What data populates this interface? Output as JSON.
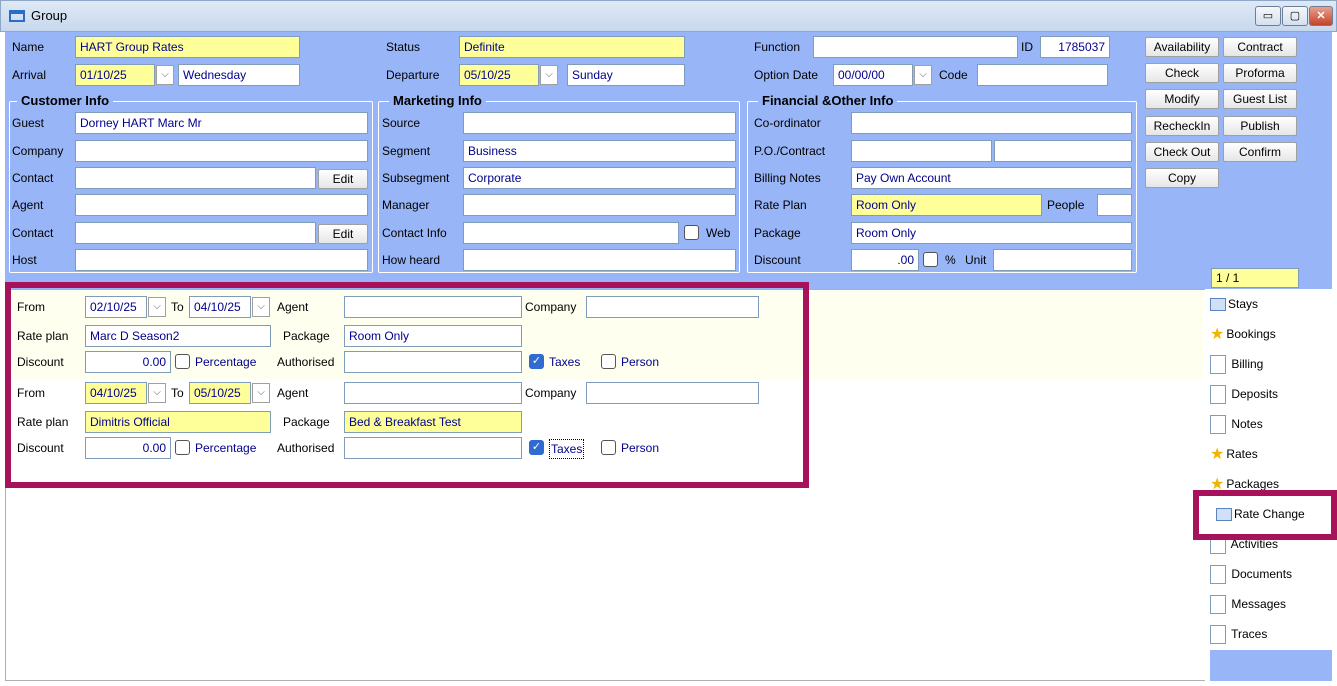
{
  "window": {
    "title": "Group",
    "controls": [
      "▭",
      "▢",
      "✕"
    ]
  },
  "header": {
    "name_label": "Name",
    "name_value": "HART Group Rates",
    "status_label": "Status",
    "status_value": "Definite",
    "function_label": "Function",
    "function_value": "",
    "id_label": "ID",
    "id_value": "1785037",
    "arrival_label": "Arrival",
    "arrival_date": "01/10/25",
    "arrival_day": "Wednesday",
    "departure_label": "Departure",
    "departure_date": "05/10/25",
    "departure_day": "Sunday",
    "option_date_label": "Option Date",
    "option_date_value": "00/00/00",
    "code_label": "Code",
    "code_value": ""
  },
  "customer_info": {
    "title": "Customer Info",
    "guest_label": "Guest",
    "guest_value": "Dorney HART Marc Mr",
    "company_label": "Company",
    "company_value": "",
    "contact_label": "Contact",
    "contact_value": "",
    "edit_label": "Edit",
    "agent_label": "Agent",
    "agent_value": "",
    "contact2_label": "Contact",
    "contact2_value": "",
    "edit2_label": "Edit",
    "host_label": "Host",
    "host_value": ""
  },
  "marketing_info": {
    "title": "Marketing Info",
    "source_label": "Source",
    "source_value": "",
    "segment_label": "Segment",
    "segment_value": "Business",
    "subsegment_label": "Subsegment",
    "subsegment_value": "Corporate",
    "manager_label": "Manager",
    "manager_value": "",
    "contact_info_label": "Contact Info",
    "contact_info_value": "",
    "web_label": "Web",
    "how_heard_label": "How heard",
    "how_heard_value": ""
  },
  "financial_info": {
    "title": "Financial &Other Info",
    "coordinator_label": "Co-ordinator",
    "coordinator_value": "",
    "po_label": "P.O./Contract",
    "po_value": "",
    "contract_value": "",
    "billing_notes_label": "Billing Notes",
    "billing_notes_value": "Pay Own Account",
    "rate_plan_label": "Rate Plan",
    "rate_plan_value": "Room Only",
    "people_label": "People",
    "people_value": "",
    "package_label": "Package",
    "package_value": "Room Only",
    "discount_label": "Discount",
    "discount_value": ".00",
    "percent_label": "%",
    "unit_label": "Unit",
    "unit_value": ""
  },
  "action_buttons": {
    "availability": "Availability",
    "contract": "Contract",
    "check": "Check",
    "proforma": "Proforma",
    "modify": "Modify",
    "guest_list": "Guest List",
    "recheckin": "RecheckIn",
    "publish": "Publish",
    "check_out": "Check Out",
    "confirm": "Confirm",
    "copy": "Copy"
  },
  "pager": "1 / 1",
  "rate_changes": [
    {
      "from_label": "From",
      "from": "02/10/25",
      "to_label": "To",
      "to": "04/10/25",
      "agent_label": "Agent",
      "agent": "",
      "company_label": "Company",
      "company": "",
      "rate_plan_label": "Rate plan",
      "rate_plan": "Marc D Season2",
      "package_label": "Package",
      "package": "Room Only",
      "discount_label": "Discount",
      "discount": "0.00",
      "percentage_label": "Percentage",
      "authorised_label": "Authorised",
      "authorised": "",
      "taxes_label": "Taxes",
      "taxes_checked": true,
      "person_label": "Person",
      "person_checked": false
    },
    {
      "from_label": "From",
      "from": "04/10/25",
      "to_label": "To",
      "to": "05/10/25",
      "agent_label": "Agent",
      "agent": "",
      "company_label": "Company",
      "company": "",
      "rate_plan_label": "Rate plan",
      "rate_plan": "Dimitris Official",
      "package_label": "Package",
      "package": "Bed & Breakfast Test",
      "discount_label": "Discount",
      "discount": "0.00",
      "percentage_label": "Percentage",
      "authorised_label": "Authorised",
      "authorised": "",
      "taxes_label": "Taxes",
      "taxes_checked": true,
      "person_label": "Person",
      "person_checked": false
    }
  ],
  "sidebar": {
    "items": [
      {
        "label": "Stays",
        "icon": "comment-icon"
      },
      {
        "label": "Bookings",
        "icon": "star-icon"
      },
      {
        "label": "Billing",
        "icon": "page-icon"
      },
      {
        "label": "Deposits",
        "icon": "page-icon"
      },
      {
        "label": "Notes",
        "icon": "page-icon"
      },
      {
        "label": "Rates",
        "icon": "star-icon"
      },
      {
        "label": "Packages",
        "icon": "star-icon"
      },
      {
        "label": "Rate Change",
        "icon": "comment-icon"
      },
      {
        "label": "Activities",
        "icon": "page-icon"
      },
      {
        "label": "Documents",
        "icon": "page-icon"
      },
      {
        "label": "Messages",
        "icon": "page-icon"
      },
      {
        "label": "Traces",
        "icon": "page-icon"
      }
    ]
  },
  "colors": {
    "panel": "#98b5f7",
    "yellow_field": "#ffff99",
    "highlight": "#a8125a",
    "row_bg": "#fffff0"
  }
}
